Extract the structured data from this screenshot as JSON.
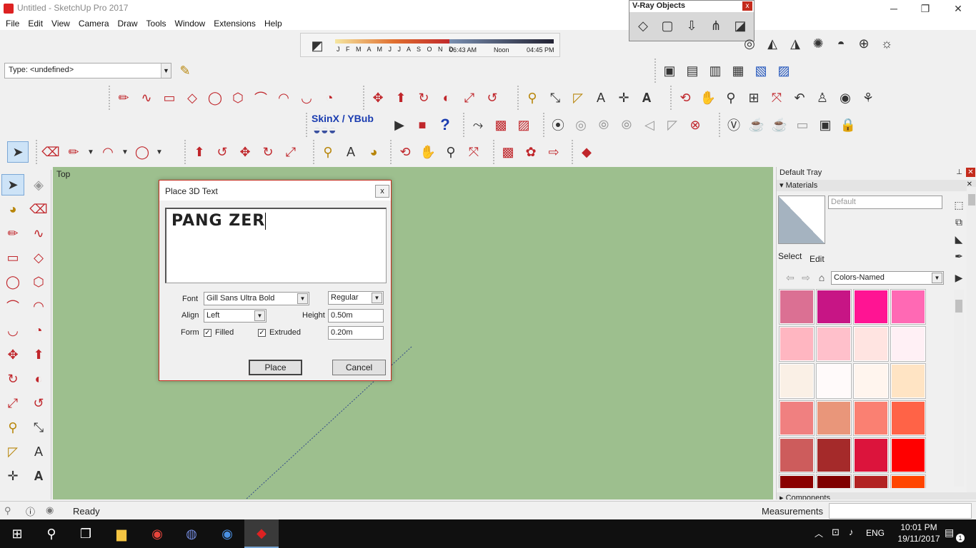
{
  "window": {
    "title": "Untitled - SketchUp Pro 2017",
    "minimize": "─",
    "maximize": "❐",
    "close": "✕"
  },
  "menu": [
    "File",
    "Edit",
    "View",
    "Camera",
    "Draw",
    "Tools",
    "Window",
    "Extensions",
    "Help"
  ],
  "type_box": {
    "value": "Type: <undefined>"
  },
  "shadows": {
    "months": "J F M A M J J A S O N D",
    "time_start": "06:43 AM",
    "time_mid": "Noon",
    "time_end": "04:45 PM"
  },
  "vray": {
    "title": "V-Ray Objects",
    "close": "x"
  },
  "skinx": {
    "label": "SkinX / YBub"
  },
  "canvas": {
    "view_label": "Top"
  },
  "dialog": {
    "title": "Place 3D Text",
    "close": "x",
    "text_value": "PANG ZER",
    "font_label": "Font",
    "font_value": "Gill Sans Ultra Bold",
    "style_value": "Regular",
    "align_label": "Align",
    "align_value": "Left",
    "height_label": "Height",
    "height_value": "0.50m",
    "form_label": "Form",
    "filled_label": "Filled",
    "extruded_label": "Extruded",
    "extrude_value": "0.20m",
    "place_button": "Place",
    "cancel_button": "Cancel"
  },
  "tray": {
    "title": "Default Tray",
    "materials_header": "Materials",
    "material_name": "Default",
    "tab_select": "Select",
    "tab_edit": "Edit",
    "library": "Colors-Named",
    "components_header": "Components",
    "swatches": [
      "#db7093",
      "#c71585",
      "#ff1493",
      "#ff69b4",
      "#ffb6c1",
      "#ffc0cb",
      "#ffe4e1",
      "#fff0f5",
      "#faf0e6",
      "#fffafa",
      "#fff5ee",
      "#ffe4c4",
      "#f08080",
      "#e9967a",
      "#fa8072",
      "#ff6347",
      "#cd5c5c",
      "#a52a2a",
      "#dc143c",
      "#ff0000",
      "#8b0000",
      "#800000",
      "#b22222",
      "#ff4500"
    ]
  },
  "status": {
    "text": "Ready",
    "measurements_label": "Measurements"
  },
  "taskbar": {
    "language": "ENG",
    "time": "10:01 PM",
    "date": "19/11/2017",
    "notification_count": "1"
  }
}
